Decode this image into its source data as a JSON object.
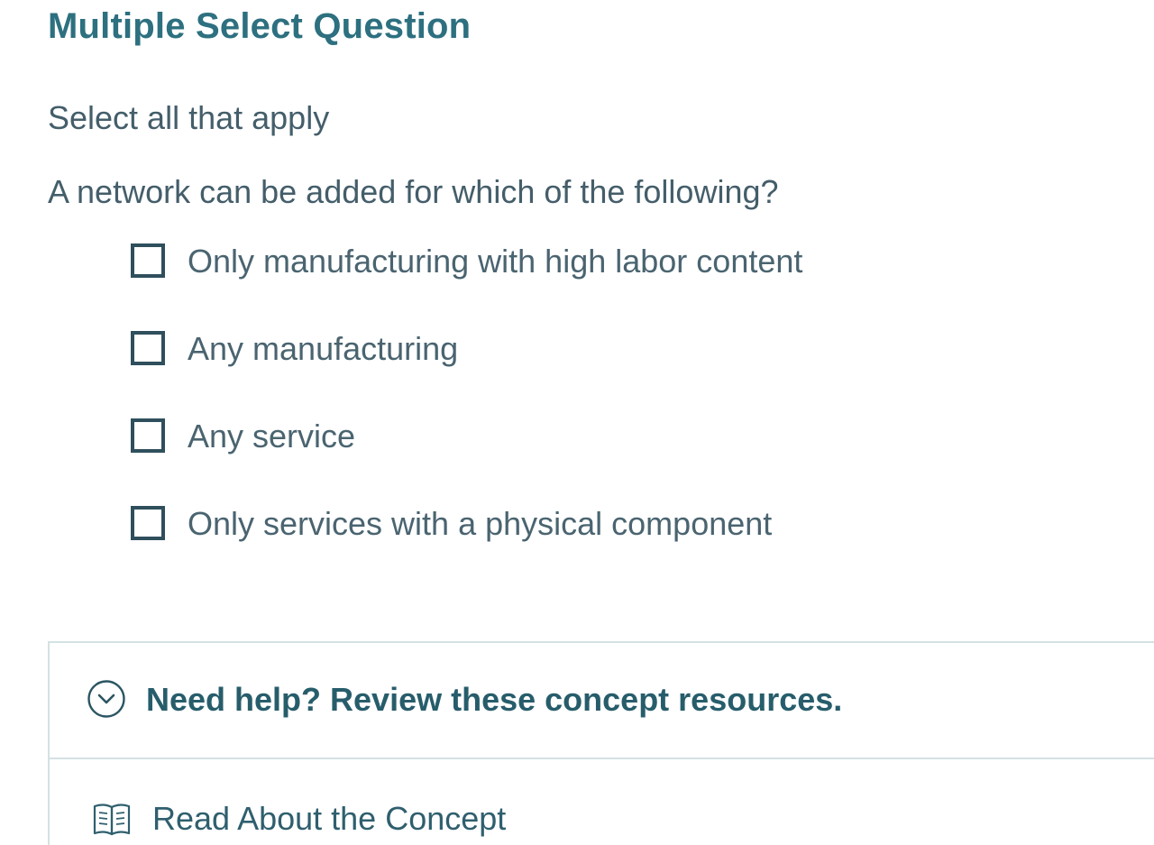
{
  "question": {
    "type_title": "Multiple Select Question",
    "instruction": "Select all that apply",
    "prompt": "A network can be added for which of the following?",
    "options": [
      {
        "label": "Only manufacturing with high labor content",
        "checked": false
      },
      {
        "label": "Any manufacturing",
        "checked": false
      },
      {
        "label": "Any service",
        "checked": false
      },
      {
        "label": "Only services with a physical component",
        "checked": false
      }
    ]
  },
  "resources": {
    "header_label": "Need help? Review these concept resources.",
    "header_icon": "chevron-down-circle-icon",
    "items": [
      {
        "label": "Read About the Concept",
        "icon": "book-icon"
      }
    ]
  },
  "colors": {
    "title": "#2d7080",
    "text": "#445e6a",
    "checkbox_border": "#2f4f5c",
    "panel_border": "#d4e1e3",
    "resources_title": "#275d6b"
  }
}
